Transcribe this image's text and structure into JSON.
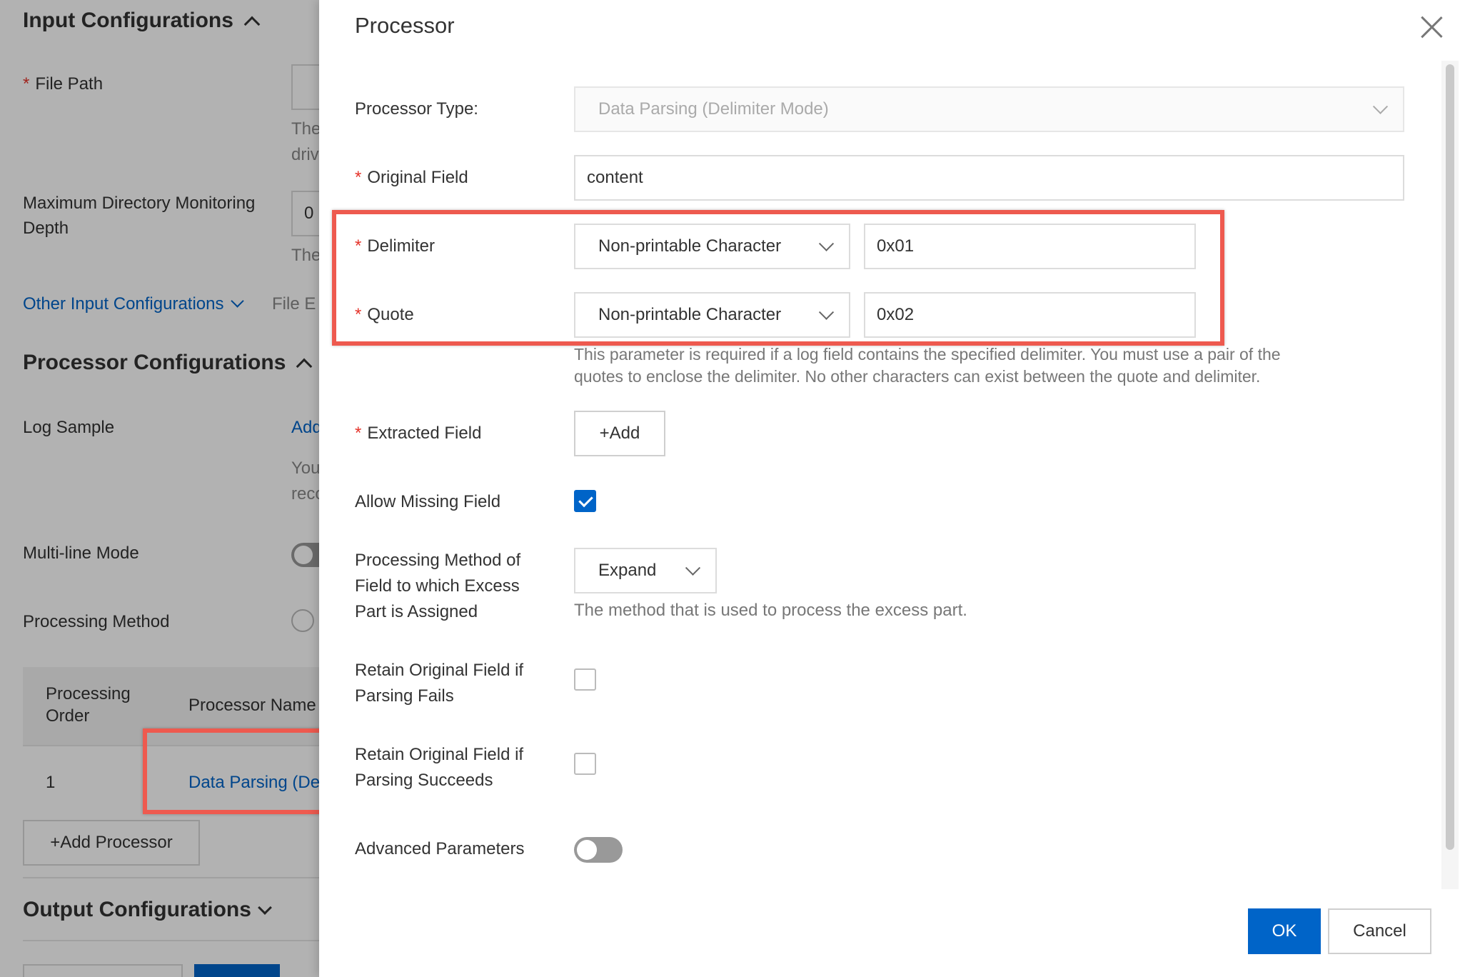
{
  "background": {
    "input_configurations": {
      "title": "Input Configurations"
    },
    "file_path_label": "File Path",
    "file_path_hint_1": "The",
    "file_path_hint_2": "driv",
    "max_depth_label_1": "Maximum Directory Monitoring",
    "max_depth_label_2": "Depth",
    "max_depth_value": "0",
    "max_depth_hint": "The",
    "other_input_link": "Other Input Configurations",
    "file_enc_partial": "File E",
    "processor_configurations": {
      "title": "Processor Configurations"
    },
    "log_sample_label": "Log Sample",
    "log_sample_link": "Add",
    "log_sample_hint_1": "You",
    "log_sample_hint_2": "reco",
    "multiline_label": "Multi-line Mode",
    "processing_method_label": "Processing Method",
    "table": {
      "col_order_1": "Processing",
      "col_order_2": "Order",
      "col_name": "Processor Name",
      "rows": [
        {
          "order": "1",
          "name": "Data Parsing (De"
        }
      ]
    },
    "add_processor_button": "+Add Processor",
    "output_configurations": {
      "title": "Output Configurations"
    }
  },
  "dialog": {
    "title": "Processor",
    "processor_type": {
      "label": "Processor Type:",
      "value": "Data Parsing (Delimiter Mode)"
    },
    "original_field": {
      "label": "Original Field",
      "value": "content"
    },
    "delimiter": {
      "label": "Delimiter",
      "type": "Non-printable Character",
      "value": "0x01"
    },
    "quote": {
      "label": "Quote",
      "type": "Non-printable Character",
      "value": "0x02",
      "hint_1": "This parameter is required if a log field contains the specified delimiter. You must use a pair of the",
      "hint_2": "quotes to enclose the delimiter. No other characters can exist between the quote and delimiter."
    },
    "extracted_field": {
      "label": "Extracted Field",
      "button": "+Add"
    },
    "allow_missing_field": {
      "label": "Allow Missing Field",
      "checked": true
    },
    "excess_processing": {
      "label_1": "Processing Method of",
      "label_2": "Field to which Excess",
      "label_3": "Part is Assigned",
      "value": "Expand",
      "hint": "The method that is used to process the excess part."
    },
    "retain_on_fail": {
      "label_1": "Retain Original Field if",
      "label_2": "Parsing Fails",
      "checked": false
    },
    "retain_on_success": {
      "label_1": "Retain Original Field if",
      "label_2": "Parsing Succeeds",
      "checked": false
    },
    "advanced_parameters": {
      "label": "Advanced Parameters",
      "on": false
    },
    "ok_button": "OK",
    "cancel_button": "Cancel"
  },
  "colors": {
    "accent": "#0064c8",
    "required": "#e5342b",
    "highlight": "#ee5a4f"
  },
  "required_mark": "*"
}
